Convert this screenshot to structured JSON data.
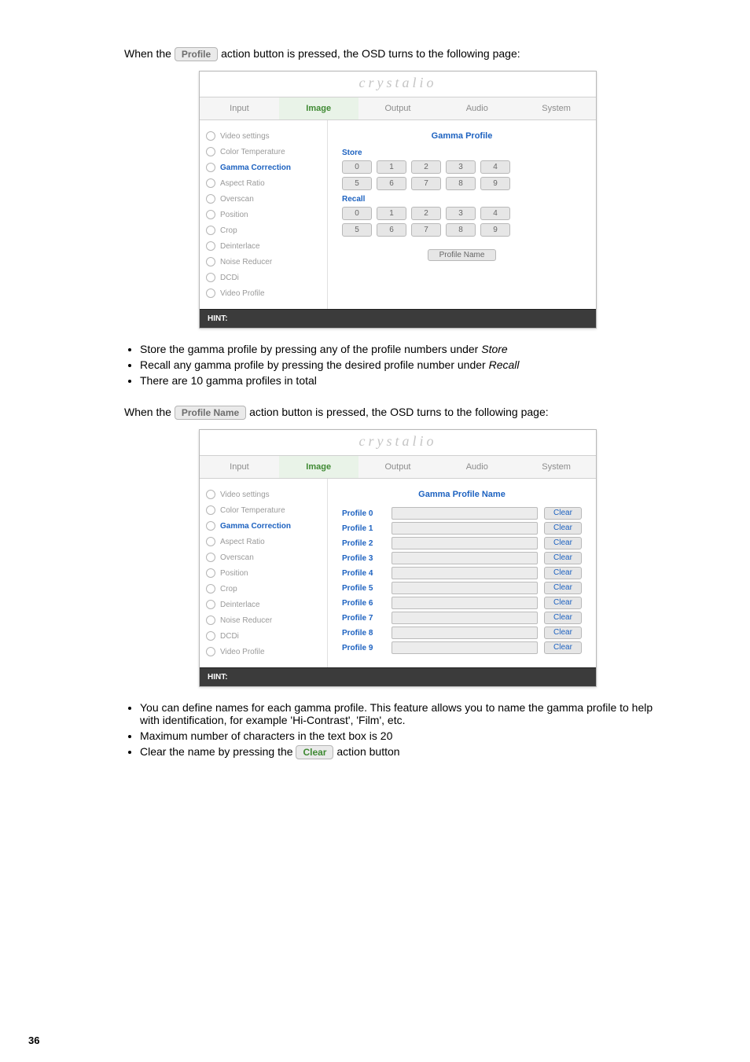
{
  "page_number": "36",
  "intro1_pre": "When the ",
  "intro1_button": "Profile",
  "intro1_post": " action button is pressed, the OSD turns to the following page:",
  "intro2_pre": "When the ",
  "intro2_button": "Profile Name",
  "intro2_post": " action button is pressed, the OSD turns to the following page:",
  "logo": "crystalio",
  "tabs": {
    "input": "Input",
    "image": "Image",
    "output": "Output",
    "audio": "Audio",
    "system": "System"
  },
  "side_items": [
    "Video settings",
    "Color Temperature",
    "Gamma Correction",
    "Aspect Ratio",
    "Overscan",
    "Position",
    "Crop",
    "Deinterlace",
    "Noise Reducer",
    "DCDi",
    "Video Profile"
  ],
  "panel1": {
    "title": "Gamma Profile",
    "store": "Store",
    "recall": "Recall",
    "nums_top": [
      "0",
      "1",
      "2",
      "3",
      "4"
    ],
    "nums_bot": [
      "5",
      "6",
      "7",
      "8",
      "9"
    ],
    "profile_name_btn": "Profile Name"
  },
  "panel2": {
    "title": "Gamma Profile Name",
    "rows": [
      "Profile 0",
      "Profile 1",
      "Profile 2",
      "Profile 3",
      "Profile 4",
      "Profile 5",
      "Profile 6",
      "Profile 7",
      "Profile 8",
      "Profile 9"
    ],
    "clear": "Clear"
  },
  "hint": "HINT:",
  "bullets1": {
    "b0_a": "Store the gamma profile by pressing any of the profile numbers under ",
    "b0_b": "Store",
    "b1_a": "Recall any gamma profile by pressing the desired profile number under ",
    "b1_b": "Recall",
    "b2": "There are 10 gamma profiles in total"
  },
  "bullets2": {
    "b0": "You can define names for each gamma profile. This feature allows you to name the gamma profile to help with identification, for example 'Hi-Contrast', 'Film', etc.",
    "b1": "Maximum number of characters in the text box is 20",
    "b2_a": "Clear the name by pressing the ",
    "b2_btn": "Clear",
    "b2_b": " action button"
  }
}
